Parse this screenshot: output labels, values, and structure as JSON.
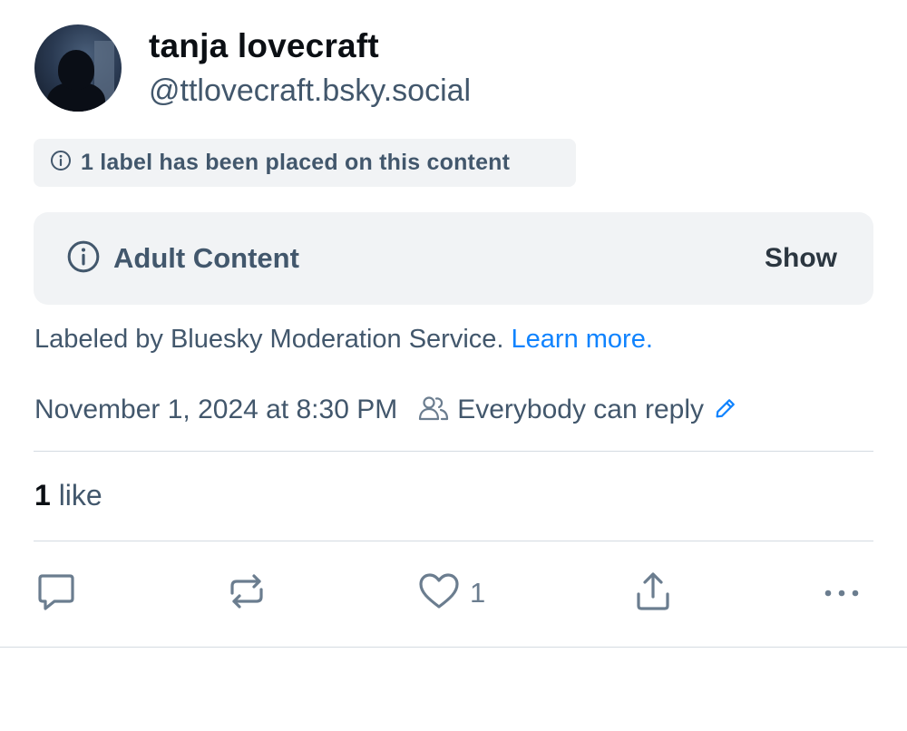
{
  "author": {
    "display_name": "tanja lovecraft",
    "handle": "@ttlovecraft.bsky.social"
  },
  "moderation": {
    "label_notice": "1 label has been placed on this content",
    "warning_title": "Adult Content",
    "show_label": "Show",
    "labeled_by_text": "Labeled by Bluesky Moderation Service.",
    "learn_more": "Learn more."
  },
  "post_meta": {
    "timestamp": "November 1, 2024 at 8:30 PM",
    "reply_setting": "Everybody can reply"
  },
  "stats": {
    "likes_count": "1",
    "likes_label": "like"
  },
  "actions": {
    "like_count": "1"
  },
  "colors": {
    "text_primary": "#0b0f14",
    "text_secondary": "#42576c",
    "link": "#1083fe",
    "surface": "#f1f3f5",
    "divider": "#d4dbe2",
    "icon": "#6b7d8f"
  },
  "icons": [
    "info-icon",
    "people-icon",
    "pencil-icon",
    "reply-icon",
    "repost-icon",
    "heart-icon",
    "share-icon",
    "more-icon"
  ]
}
